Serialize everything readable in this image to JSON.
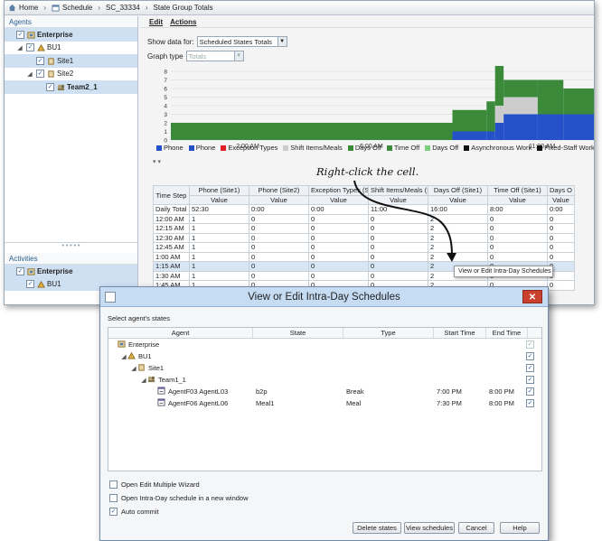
{
  "breadcrumb": [
    "Home",
    "Schedule",
    "SC_33334",
    "State Group Totals"
  ],
  "agents_panel": {
    "title": "Agents",
    "tree": [
      {
        "label": "Enterprise",
        "level": 0,
        "toggle": "",
        "checked": true,
        "bold": true,
        "icon": "enterprise-icon",
        "selected": true
      },
      {
        "label": "BU1",
        "level": 1,
        "toggle": "◢",
        "checked": true,
        "bold": false,
        "icon": "business-unit-icon",
        "selected": false
      },
      {
        "label": "Site1",
        "level": 2,
        "toggle": "",
        "checked": true,
        "bold": false,
        "icon": "site-icon",
        "selected": true
      },
      {
        "label": "Site2",
        "level": 2,
        "toggle": "◢",
        "checked": true,
        "bold": false,
        "icon": "site-icon",
        "selected": false
      },
      {
        "label": "Team2_1",
        "level": 3,
        "toggle": "",
        "checked": true,
        "bold": true,
        "icon": "team-icon",
        "selected": true
      }
    ]
  },
  "activities_panel": {
    "title": "Activities",
    "tree": [
      {
        "label": "Enterprise",
        "level": 0,
        "toggle": "",
        "checked": true,
        "bold": true,
        "icon": "enterprise-icon",
        "selected": true
      },
      {
        "label": "BU1",
        "level": 1,
        "toggle": "",
        "checked": true,
        "bold": false,
        "icon": "business-unit-icon",
        "selected": true
      }
    ]
  },
  "menu": {
    "edit": "Edit",
    "actions": "Actions"
  },
  "controls": {
    "show_data_label": "Show data for:",
    "show_data_value": "Scheduled States Totals",
    "graph_type_label": "Graph type",
    "graph_type_value": "Totals"
  },
  "chart_data": {
    "type": "area",
    "x_tick_labels": [
      "2:00 AM",
      "6:00 AM",
      "11:00 AM"
    ],
    "y_ticks": [
      0,
      1,
      2,
      3,
      4,
      5,
      6,
      7,
      8
    ],
    "ylim": [
      0,
      8
    ],
    "grid": true,
    "colors": {
      "phone": "#2450c8",
      "days_off": "#3a8a3a",
      "shift_items": "#cccccc"
    },
    "legend": [
      {
        "name": "Phone",
        "color": "#2450c8"
      },
      {
        "name": "Phone",
        "color": "#2450c8"
      },
      {
        "name": "Exception Types",
        "color": "#e02020"
      },
      {
        "name": "Shift Items/Meals",
        "color": "#cccccc"
      },
      {
        "name": "Days Off",
        "color": "#3a8a3a"
      },
      {
        "name": "Time Off",
        "color": "#3a8a3a"
      },
      {
        "name": "Days Off",
        "color": "#7ccf7c"
      },
      {
        "name": "Asynchronous Work",
        "color": "#111111"
      },
      {
        "name": "Fixed-Staff Work",
        "color": "#111111"
      }
    ]
  },
  "table": {
    "group_headers": [
      "Phone (Site1)",
      "Phone (Site2)",
      "Exception Types (Sit...",
      "Shift Items/Meals (S...",
      "Days Off (Site1)",
      "Time Off (Site1)",
      "Days O"
    ],
    "sub_header": "Value",
    "time_step_header": "Time Step",
    "rows": [
      {
        "time": "Daily Total",
        "values": [
          "52:30",
          "0:00",
          "0:00",
          "11:00",
          "16:00",
          "8:00",
          "0:00"
        ]
      },
      {
        "time": "12:00 AM",
        "values": [
          "1",
          "0",
          "0",
          "0",
          "2",
          "0",
          "0"
        ]
      },
      {
        "time": "12:15 AM",
        "values": [
          "1",
          "0",
          "0",
          "0",
          "2",
          "0",
          "0"
        ]
      },
      {
        "time": "12:30 AM",
        "values": [
          "1",
          "0",
          "0",
          "0",
          "2",
          "0",
          "0"
        ]
      },
      {
        "time": "12:45 AM",
        "values": [
          "1",
          "0",
          "0",
          "0",
          "2",
          "0",
          "0"
        ]
      },
      {
        "time": "1:00 AM",
        "values": [
          "1",
          "0",
          "0",
          "0",
          "2",
          "0",
          "0"
        ]
      },
      {
        "time": "1:15 AM",
        "values": [
          "1",
          "0",
          "0",
          "0",
          "2",
          "0",
          "0"
        ]
      },
      {
        "time": "1:30 AM",
        "values": [
          "1",
          "0",
          "0",
          "0",
          "2",
          "0",
          "0"
        ]
      },
      {
        "time": "1:45 AM",
        "values": [
          "1",
          "0",
          "0",
          "0",
          "2",
          "0",
          "0"
        ]
      }
    ]
  },
  "annotation": "Right-click the cell.",
  "context_menu_item": "View or Edit Intra-Day Schedules",
  "dialog": {
    "title": "View or Edit Intra-Day Schedules",
    "subtitle": "Select agent's states",
    "columns": [
      "Agent",
      "State",
      "Type",
      "Start Time",
      "End Time"
    ],
    "rows": [
      {
        "agent": "Enterprise",
        "state": "",
        "type": "",
        "start": "",
        "end": "",
        "indent": 0,
        "toggle": "",
        "checked": true,
        "disabled": true
      },
      {
        "agent": "BU1",
        "state": "",
        "type": "",
        "start": "",
        "end": "",
        "indent": 1,
        "toggle": "◢",
        "checked": true,
        "disabled": false
      },
      {
        "agent": "Site1",
        "state": "",
        "type": "",
        "start": "",
        "end": "",
        "indent": 2,
        "toggle": "◢",
        "checked": true,
        "disabled": false
      },
      {
        "agent": "Team1_1",
        "state": "",
        "type": "",
        "start": "",
        "end": "",
        "indent": 3,
        "toggle": "◢",
        "checked": true,
        "disabled": false
      },
      {
        "agent": "AgentF03 AgentL03",
        "state": "b2p",
        "type": "Break",
        "start": "7:00 PM",
        "end": "8:00 PM",
        "indent": 4,
        "toggle": "",
        "checked": true,
        "disabled": false
      },
      {
        "agent": "AgentF06 AgentL06",
        "state": "Meal1",
        "type": "Meal",
        "start": "7:30 PM",
        "end": "8:00 PM",
        "indent": 4,
        "toggle": "",
        "checked": true,
        "disabled": false
      }
    ],
    "options": [
      {
        "label": "Open Edit Multiple Wizard",
        "checked": false
      },
      {
        "label": "Open Intra-Day schedule in a new window",
        "checked": false
      },
      {
        "label": "Auto commit",
        "checked": true
      }
    ],
    "buttons": [
      "Delete states",
      "View schedules",
      "Cancel",
      "Help"
    ]
  }
}
